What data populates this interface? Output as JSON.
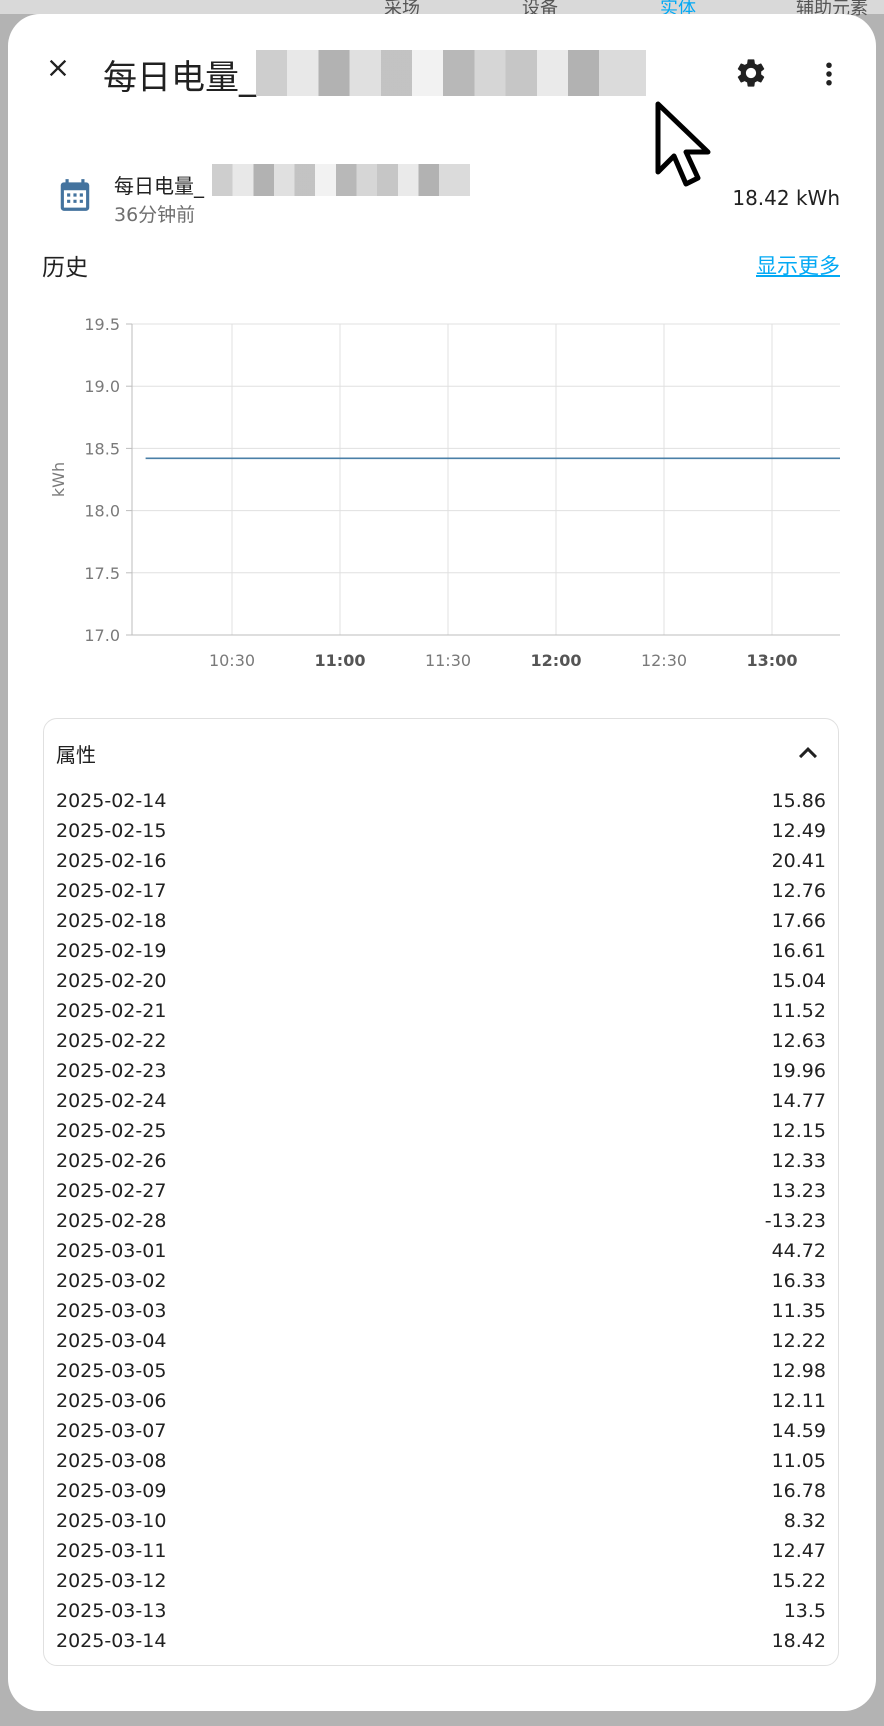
{
  "backdrop": {
    "tabs": [
      "采场",
      "设备",
      "实体",
      "辅助元素"
    ]
  },
  "dialog": {
    "title": "每日电量_"
  },
  "entity": {
    "name": "每日电量_",
    "last_changed": "36分钟前",
    "state": "18.42 kWh"
  },
  "history": {
    "title": "历史",
    "show_more": "显示更多"
  },
  "chart_data": {
    "type": "line",
    "ylabel": "kWh",
    "ylim": [
      17.0,
      19.5
    ],
    "y_ticks": [
      "19.5",
      "19.0",
      "18.5",
      "18.0",
      "17.5",
      "17.0"
    ],
    "x_ticks": [
      "10:30",
      "11:00",
      "11:30",
      "12:00",
      "12:30",
      "13:00"
    ],
    "x_ticks_bold": [
      "11:00",
      "12:00",
      "13:00"
    ],
    "series": [
      {
        "x": [
          "10:06",
          "13:20"
        ],
        "values": [
          18.42,
          18.42
        ]
      }
    ],
    "grid": true,
    "line_color": "#4a7fa7"
  },
  "attributes": {
    "title": "属性",
    "rows": [
      {
        "date": "2025-02-14",
        "value": "15.86"
      },
      {
        "date": "2025-02-15",
        "value": "12.49"
      },
      {
        "date": "2025-02-16",
        "value": "20.41"
      },
      {
        "date": "2025-02-17",
        "value": "12.76"
      },
      {
        "date": "2025-02-18",
        "value": "17.66"
      },
      {
        "date": "2025-02-19",
        "value": "16.61"
      },
      {
        "date": "2025-02-20",
        "value": "15.04"
      },
      {
        "date": "2025-02-21",
        "value": "11.52"
      },
      {
        "date": "2025-02-22",
        "value": "12.63"
      },
      {
        "date": "2025-02-23",
        "value": "19.96"
      },
      {
        "date": "2025-02-24",
        "value": "14.77"
      },
      {
        "date": "2025-02-25",
        "value": "12.15"
      },
      {
        "date": "2025-02-26",
        "value": "12.33"
      },
      {
        "date": "2025-02-27",
        "value": "13.23"
      },
      {
        "date": "2025-02-28",
        "value": "-13.23"
      },
      {
        "date": "2025-03-01",
        "value": "44.72"
      },
      {
        "date": "2025-03-02",
        "value": "16.33"
      },
      {
        "date": "2025-03-03",
        "value": "11.35"
      },
      {
        "date": "2025-03-04",
        "value": "12.22"
      },
      {
        "date": "2025-03-05",
        "value": "12.98"
      },
      {
        "date": "2025-03-06",
        "value": "12.11"
      },
      {
        "date": "2025-03-07",
        "value": "14.59"
      },
      {
        "date": "2025-03-08",
        "value": "11.05"
      },
      {
        "date": "2025-03-09",
        "value": "16.78"
      },
      {
        "date": "2025-03-10",
        "value": "8.32"
      },
      {
        "date": "2025-03-11",
        "value": "12.47"
      },
      {
        "date": "2025-03-12",
        "value": "15.22"
      },
      {
        "date": "2025-03-13",
        "value": "13.5"
      },
      {
        "date": "2025-03-14",
        "value": "18.42"
      }
    ]
  },
  "icons": {
    "close": "close-icon",
    "settings": "gear-icon",
    "more": "more-vert-icon",
    "entity": "calendar-icon",
    "collapse": "chevron-up-icon",
    "cursor": "mouse-cursor-icon"
  },
  "colors": {
    "accent": "#03a9f4",
    "entity_icon": "#44739e",
    "line": "#4a7fa7"
  }
}
